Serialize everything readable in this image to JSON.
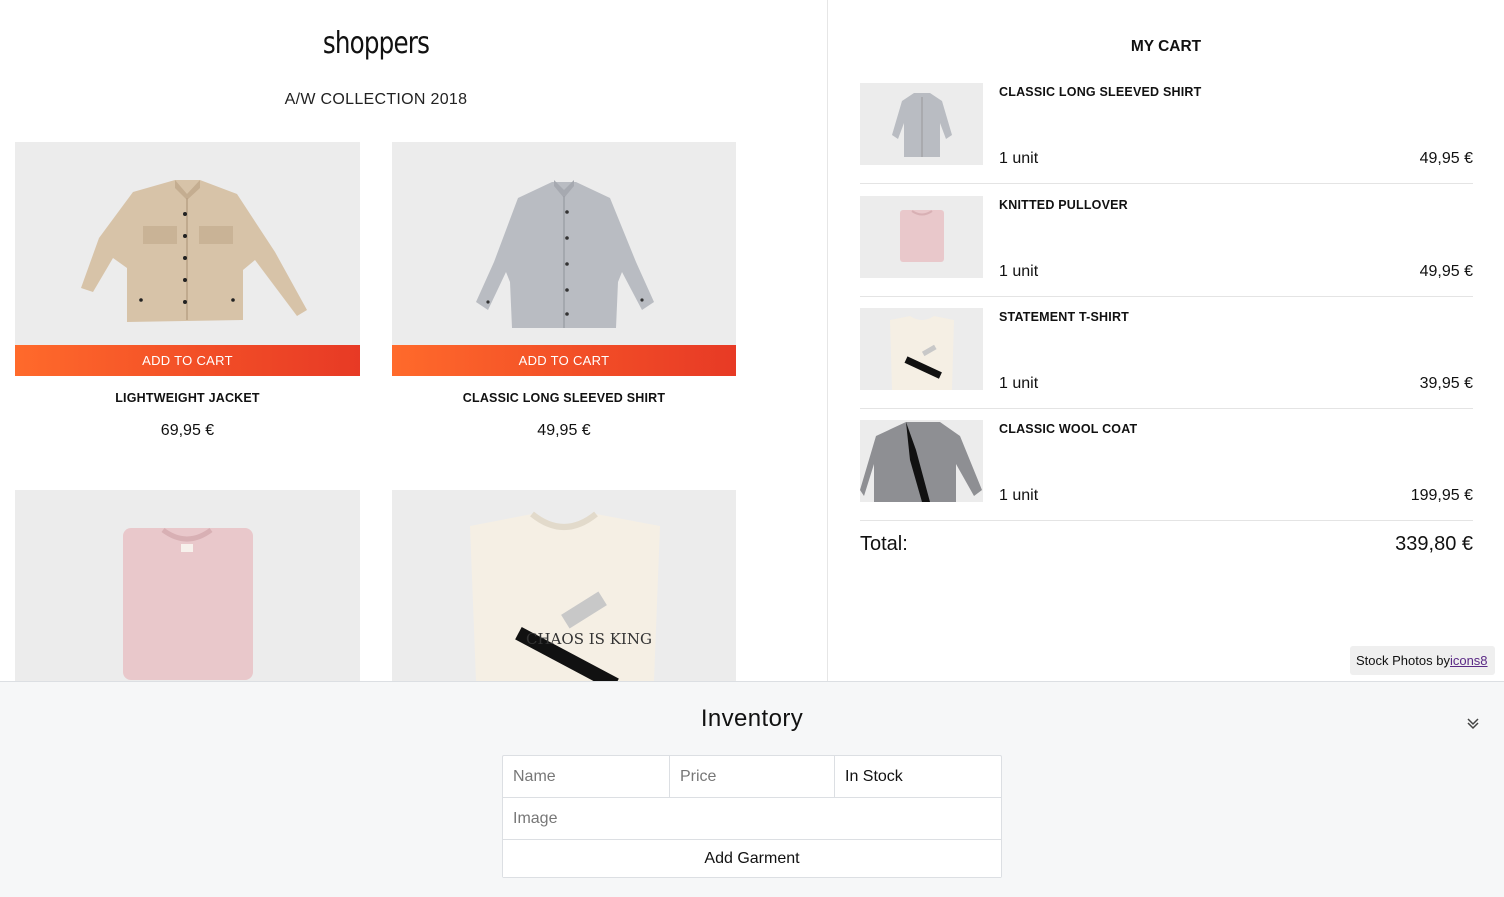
{
  "store": {
    "brand": "shoppers",
    "collection": "A/W COLLECTION 2018"
  },
  "products": [
    {
      "name": "LIGHTWEIGHT JACKET",
      "price": "69,95 €",
      "add_label": "ADD TO CART",
      "image": "beige-jacket"
    },
    {
      "name": "CLASSIC LONG SLEEVED SHIRT",
      "price": "49,95 €",
      "add_label": "ADD TO CART",
      "image": "grey-shirt"
    },
    {
      "image": "pink-pullover"
    },
    {
      "image": "statement-tshirt",
      "print_text": "CHAOS IS KING"
    }
  ],
  "cart": {
    "title": "MY CART",
    "items": [
      {
        "name": "CLASSIC LONG SLEEVED SHIRT",
        "qty": "1 unit",
        "price": "49,95 €",
        "image": "grey-shirt"
      },
      {
        "name": "KNITTED PULLOVER",
        "qty": "1 unit",
        "price": "49,95 €",
        "image": "pink-pullover"
      },
      {
        "name": "STATEMENT T-SHIRT",
        "qty": "1 unit",
        "price": "39,95 €",
        "image": "statement-tshirt"
      },
      {
        "name": "CLASSIC WOOL COAT",
        "qty": "1 unit",
        "price": "199,95 €",
        "image": "wool-coat"
      }
    ],
    "total_label": "Total:",
    "total_value": "339,80 €"
  },
  "credit": {
    "prefix": "Stock Photos by",
    "link": "icons8"
  },
  "inventory": {
    "title": "Inventory",
    "name_placeholder": "Name",
    "price_placeholder": "Price",
    "stock_value": "In Stock",
    "image_placeholder": "Image",
    "submit_label": "Add Garment",
    "collapse_icon": "double-chevron-down-icon"
  },
  "colors": {
    "accent_start": "#ff6a2b",
    "accent_end": "#e73a25",
    "photo_bg": "#ececec",
    "panel_bg": "#f6f7f8"
  }
}
